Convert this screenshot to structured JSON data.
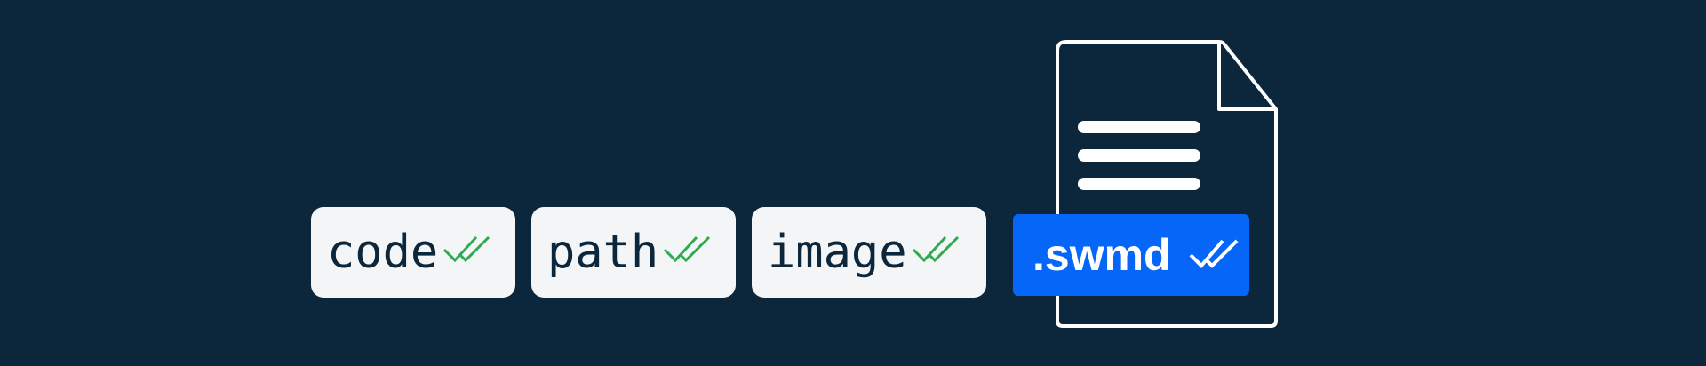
{
  "colors": {
    "background": "#0c263b",
    "chip_background": "#f3f5f7",
    "chip_text": "#0c263b",
    "check_green": "#2eab4f",
    "badge_blue": "#0566f8",
    "white": "#ffffff"
  },
  "chips": [
    {
      "label": "code",
      "icon": "double-check-icon"
    },
    {
      "label": "path",
      "icon": "double-check-icon"
    },
    {
      "label": "image",
      "icon": "double-check-icon"
    }
  ],
  "file": {
    "icon": "document-icon",
    "extension_label": ".swmd",
    "extension_icon": "double-check-icon"
  }
}
